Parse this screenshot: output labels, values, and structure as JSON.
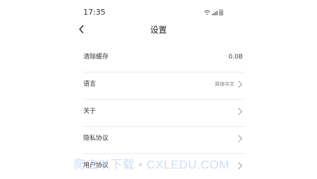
{
  "status_bar": {
    "time": "17:35",
    "icons": [
      "wifi-icon",
      "signal-icon",
      "battery-icon"
    ]
  },
  "header": {
    "title": "设置",
    "back_icon": "chevron-left-icon"
  },
  "settings": {
    "items": [
      {
        "label": "清除缓存",
        "value": "0.0B"
      },
      {
        "label": "语言",
        "value": "简体中文"
      },
      {
        "label": "关于"
      },
      {
        "label": "隐私协议"
      },
      {
        "label": "用户协议"
      }
    ]
  },
  "watermark": {
    "text": "爬虫以下载 • CXLEDU.COM"
  },
  "colors": {
    "text": "#333333",
    "divider": "#ececec",
    "chevron": "#999999",
    "watermark": "#96b4f0"
  }
}
